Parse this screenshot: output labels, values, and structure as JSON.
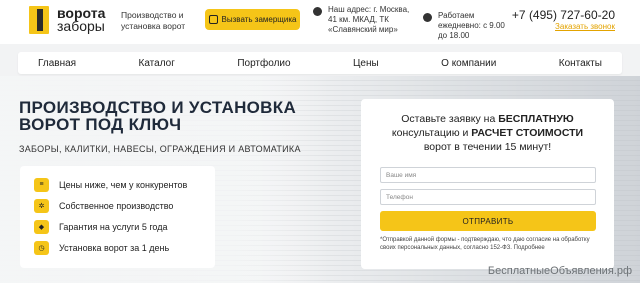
{
  "header": {
    "logo_line1": "ворота",
    "logo_line2": "заборы",
    "tagline": "Производство и установка ворот",
    "call_button": "Вызвать замерщика",
    "address": "Наш адрес: г. Москва, 41 км. МКАД, ТК «Славянский мир»",
    "hours": "Работаем ежедневно: с 9.00 до 18.00",
    "phone": "+7 (495) 727-60-20",
    "callback": "Заказать звонок"
  },
  "nav": [
    "Главная",
    "Каталог",
    "Портфолио",
    "Цены",
    "О компании",
    "Контакты"
  ],
  "hero": {
    "title_line1": "ПРОИЗВОДСТВО И УСТАНОВКА",
    "title_line2": "ВОРОТ ПОД КЛЮЧ",
    "subtitle": "ЗАБОРЫ, КАЛИТКИ, НАВЕСЫ, ОГРАЖДЕНИЯ И АВТОМАТИКА"
  },
  "features": [
    {
      "icon": "coins-icon",
      "text": "Цены ниже, чем у конкурентов"
    },
    {
      "icon": "gears-icon",
      "text": "Собственное производство"
    },
    {
      "icon": "shield-icon",
      "text": "Гарантия на услуги 5 года"
    },
    {
      "icon": "clock-icon",
      "text": "Установка ворот за 1 день"
    }
  ],
  "form": {
    "title_a": "Оставьте заявку на ",
    "title_b": "БЕСПЛАТНУЮ",
    "title_c": " консультацию и ",
    "title_d": "РАСЧЕТ СТОИМОСТИ",
    "title_e": " ворот в течении 15 минут!",
    "name_placeholder": "Ваше имя",
    "phone_placeholder": "Телефон",
    "submit": "ОТПРАВИТЬ",
    "note": "*Отправкой данной формы - подтверждаю, что даю согласие на обработку своих персональных данных, согласно 152-ФЗ. Подробнее"
  },
  "watermark": "БесплатныеОбъявления.рф",
  "colors": {
    "accent": "#f5c518",
    "text": "#222222",
    "title": "#1f2a3a"
  }
}
